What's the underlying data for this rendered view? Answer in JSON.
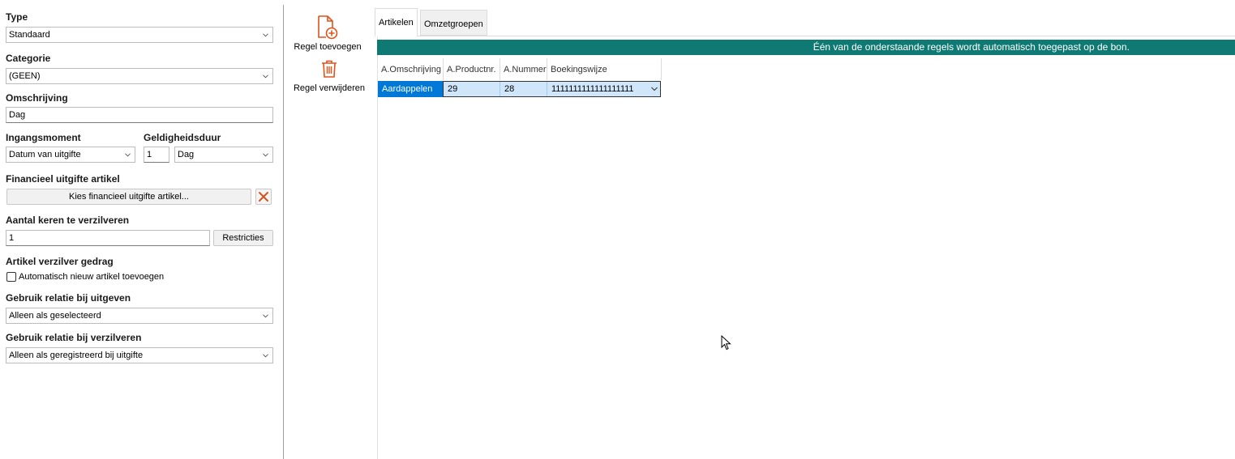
{
  "form": {
    "type_label": "Type",
    "type_value": "Standaard",
    "categorie_label": "Categorie",
    "categorie_value": "(GEEN)",
    "omschrijving_label": "Omschrijving",
    "omschrijving_value": "Dag",
    "ingangsmoment_label": "Ingangsmoment",
    "ingangsmoment_value": "Datum van uitgifte",
    "geldigheidsduur_label": "Geldigheidsduur",
    "geldigheidsduur_amount": "1",
    "geldigheidsduur_unit": "Dag",
    "financieel_label": "Financieel uitgifte artikel",
    "financieel_button": "Kies financieel uitgifte artikel...",
    "aantal_label": "Aantal keren te verzilveren",
    "aantal_value": "1",
    "restricties_button": "Restricties",
    "verzilver_gedrag_label": "Artikel verzilver gedrag",
    "auto_nieuw_label": "Automatisch nieuw artikel toevoegen",
    "auto_nieuw_checked": false,
    "relatie_uitgeven_label": "Gebruik relatie bij uitgeven",
    "relatie_uitgeven_value": "Alleen als geselecteerd",
    "relatie_verzilveren_label": "Gebruik relatie bij verzilveren",
    "relatie_verzilveren_value": "Alleen als geregistreerd bij uitgifte"
  },
  "toolbar": {
    "add_label": "Regel toevoegen",
    "remove_label": "Regel verwijderen",
    "accent_color": "#e0521a"
  },
  "tabs": [
    {
      "label": "Artikelen",
      "active": true
    },
    {
      "label": "Omzetgroepen",
      "active": false
    }
  ],
  "banner": {
    "text": "Één van de onderstaande regels wordt automatisch toegepast op de bon.",
    "color": "#0f7a73"
  },
  "grid": {
    "columns": [
      "A.Omschrijving",
      "A.Productnr.",
      "A.Nummer",
      "Boekingswijze"
    ],
    "rows": [
      [
        "Aardappelen",
        "29",
        "28",
        "1111111111111111111"
      ]
    ]
  }
}
